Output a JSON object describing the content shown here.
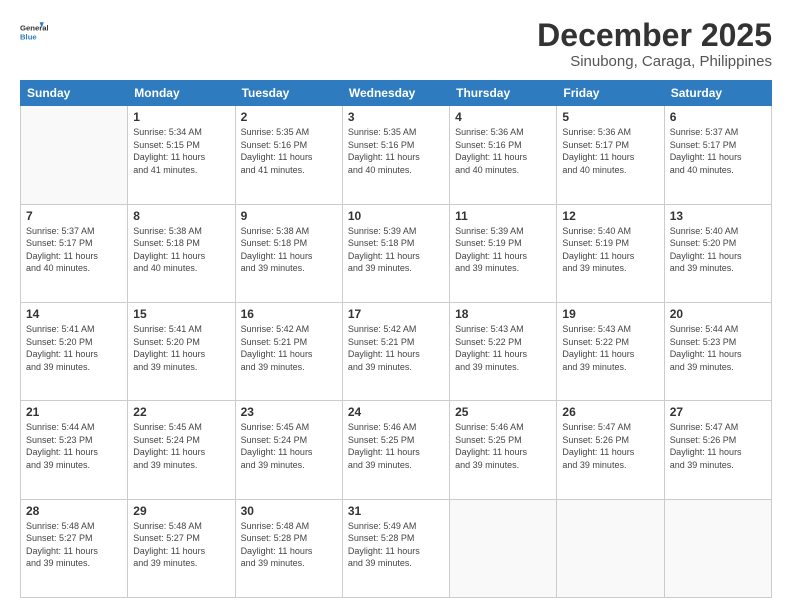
{
  "header": {
    "logo": {
      "line1": "General",
      "line2": "Blue"
    },
    "title": "December 2025",
    "location": "Sinubong, Caraga, Philippines"
  },
  "weekdays": [
    "Sunday",
    "Monday",
    "Tuesday",
    "Wednesday",
    "Thursday",
    "Friday",
    "Saturday"
  ],
  "weeks": [
    [
      {
        "day": "",
        "info": ""
      },
      {
        "day": "1",
        "info": "Sunrise: 5:34 AM\nSunset: 5:15 PM\nDaylight: 11 hours\nand 41 minutes."
      },
      {
        "day": "2",
        "info": "Sunrise: 5:35 AM\nSunset: 5:16 PM\nDaylight: 11 hours\nand 41 minutes."
      },
      {
        "day": "3",
        "info": "Sunrise: 5:35 AM\nSunset: 5:16 PM\nDaylight: 11 hours\nand 40 minutes."
      },
      {
        "day": "4",
        "info": "Sunrise: 5:36 AM\nSunset: 5:16 PM\nDaylight: 11 hours\nand 40 minutes."
      },
      {
        "day": "5",
        "info": "Sunrise: 5:36 AM\nSunset: 5:17 PM\nDaylight: 11 hours\nand 40 minutes."
      },
      {
        "day": "6",
        "info": "Sunrise: 5:37 AM\nSunset: 5:17 PM\nDaylight: 11 hours\nand 40 minutes."
      }
    ],
    [
      {
        "day": "7",
        "info": "Sunrise: 5:37 AM\nSunset: 5:17 PM\nDaylight: 11 hours\nand 40 minutes."
      },
      {
        "day": "8",
        "info": "Sunrise: 5:38 AM\nSunset: 5:18 PM\nDaylight: 11 hours\nand 40 minutes."
      },
      {
        "day": "9",
        "info": "Sunrise: 5:38 AM\nSunset: 5:18 PM\nDaylight: 11 hours\nand 39 minutes."
      },
      {
        "day": "10",
        "info": "Sunrise: 5:39 AM\nSunset: 5:18 PM\nDaylight: 11 hours\nand 39 minutes."
      },
      {
        "day": "11",
        "info": "Sunrise: 5:39 AM\nSunset: 5:19 PM\nDaylight: 11 hours\nand 39 minutes."
      },
      {
        "day": "12",
        "info": "Sunrise: 5:40 AM\nSunset: 5:19 PM\nDaylight: 11 hours\nand 39 minutes."
      },
      {
        "day": "13",
        "info": "Sunrise: 5:40 AM\nSunset: 5:20 PM\nDaylight: 11 hours\nand 39 minutes."
      }
    ],
    [
      {
        "day": "14",
        "info": "Sunrise: 5:41 AM\nSunset: 5:20 PM\nDaylight: 11 hours\nand 39 minutes."
      },
      {
        "day": "15",
        "info": "Sunrise: 5:41 AM\nSunset: 5:20 PM\nDaylight: 11 hours\nand 39 minutes."
      },
      {
        "day": "16",
        "info": "Sunrise: 5:42 AM\nSunset: 5:21 PM\nDaylight: 11 hours\nand 39 minutes."
      },
      {
        "day": "17",
        "info": "Sunrise: 5:42 AM\nSunset: 5:21 PM\nDaylight: 11 hours\nand 39 minutes."
      },
      {
        "day": "18",
        "info": "Sunrise: 5:43 AM\nSunset: 5:22 PM\nDaylight: 11 hours\nand 39 minutes."
      },
      {
        "day": "19",
        "info": "Sunrise: 5:43 AM\nSunset: 5:22 PM\nDaylight: 11 hours\nand 39 minutes."
      },
      {
        "day": "20",
        "info": "Sunrise: 5:44 AM\nSunset: 5:23 PM\nDaylight: 11 hours\nand 39 minutes."
      }
    ],
    [
      {
        "day": "21",
        "info": "Sunrise: 5:44 AM\nSunset: 5:23 PM\nDaylight: 11 hours\nand 39 minutes."
      },
      {
        "day": "22",
        "info": "Sunrise: 5:45 AM\nSunset: 5:24 PM\nDaylight: 11 hours\nand 39 minutes."
      },
      {
        "day": "23",
        "info": "Sunrise: 5:45 AM\nSunset: 5:24 PM\nDaylight: 11 hours\nand 39 minutes."
      },
      {
        "day": "24",
        "info": "Sunrise: 5:46 AM\nSunset: 5:25 PM\nDaylight: 11 hours\nand 39 minutes."
      },
      {
        "day": "25",
        "info": "Sunrise: 5:46 AM\nSunset: 5:25 PM\nDaylight: 11 hours\nand 39 minutes."
      },
      {
        "day": "26",
        "info": "Sunrise: 5:47 AM\nSunset: 5:26 PM\nDaylight: 11 hours\nand 39 minutes."
      },
      {
        "day": "27",
        "info": "Sunrise: 5:47 AM\nSunset: 5:26 PM\nDaylight: 11 hours\nand 39 minutes."
      }
    ],
    [
      {
        "day": "28",
        "info": "Sunrise: 5:48 AM\nSunset: 5:27 PM\nDaylight: 11 hours\nand 39 minutes."
      },
      {
        "day": "29",
        "info": "Sunrise: 5:48 AM\nSunset: 5:27 PM\nDaylight: 11 hours\nand 39 minutes."
      },
      {
        "day": "30",
        "info": "Sunrise: 5:48 AM\nSunset: 5:28 PM\nDaylight: 11 hours\nand 39 minutes."
      },
      {
        "day": "31",
        "info": "Sunrise: 5:49 AM\nSunset: 5:28 PM\nDaylight: 11 hours\nand 39 minutes."
      },
      {
        "day": "",
        "info": ""
      },
      {
        "day": "",
        "info": ""
      },
      {
        "day": "",
        "info": ""
      }
    ]
  ]
}
